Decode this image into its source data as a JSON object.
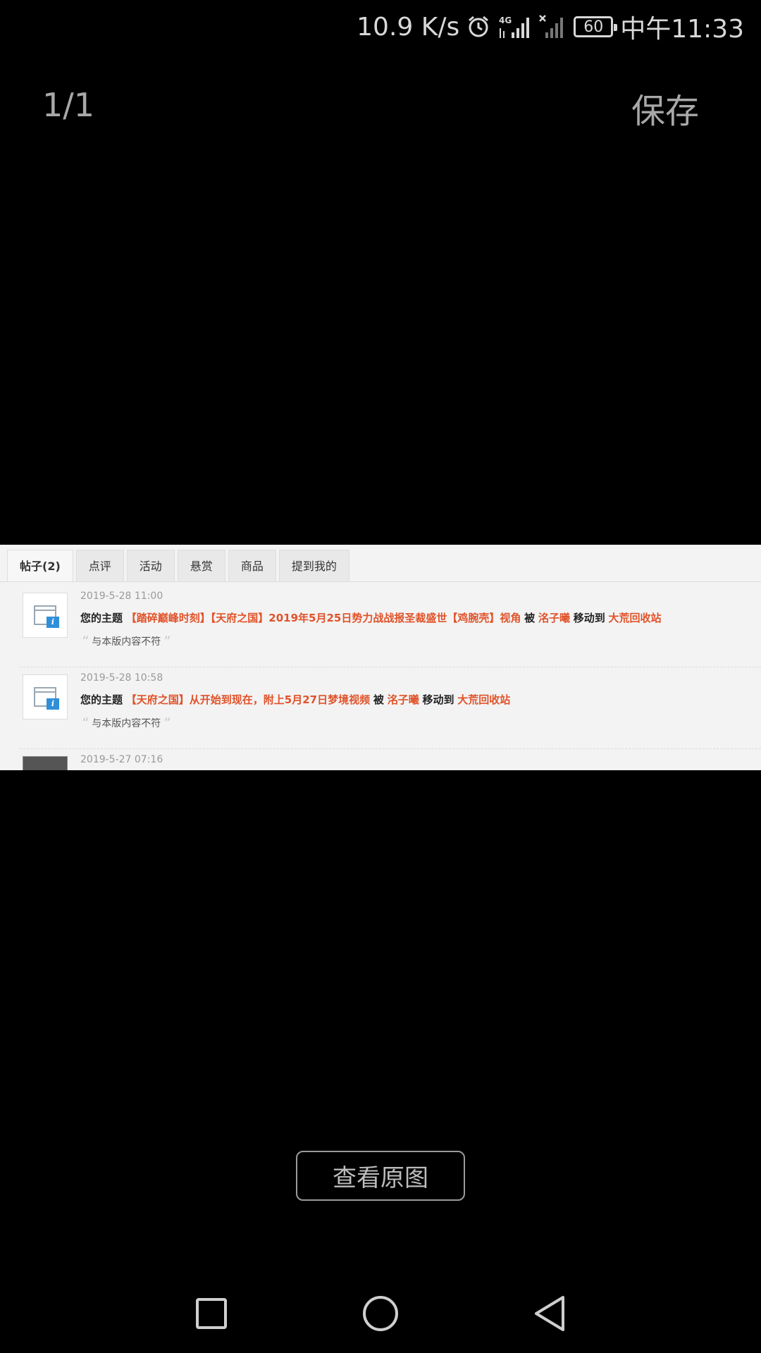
{
  "status_bar": {
    "net_speed": "10.9 K/s",
    "network": "4G",
    "battery": "60",
    "time": "中午11:33",
    "icons": [
      "alarm-icon",
      "signal-4g-icon",
      "signal-no-sim-icon",
      "battery-icon"
    ]
  },
  "viewer": {
    "page_counter": "1/1",
    "save_label": "保存",
    "view_original_label": "查看原图"
  },
  "image": {
    "tabs": [
      "帖子(2)",
      "点评",
      "活动",
      "悬赏",
      "商品",
      "提到我的"
    ],
    "active_tab": 0,
    "notices": [
      {
        "time": "2019-5-28 11:00",
        "prefix": "您的主题",
        "title": "【踏碎巅峰时刻】【天府之国】2019年5月25日势力战战报圣裁盛世【鸡腕壳】视角",
        "by": "被",
        "user": "洺子曦",
        "moved_to": "移动到",
        "forum": "大荒回收站",
        "reason": "与本版内容不符"
      },
      {
        "time": "2019-5-28 10:58",
        "prefix": "您的主题",
        "title": "【天府之国】从开始到现在，附上5月27日梦境视频",
        "by": "被",
        "user": "洺子曦",
        "moved_to": "移动到",
        "forum": "大荒回收站",
        "reason": "与本版内容不符"
      },
      {
        "time": "2019-5-27 07:16"
      }
    ]
  },
  "nav_bar": {
    "icons": [
      "recents-square-icon",
      "home-circle-icon",
      "back-triangle-icon"
    ]
  },
  "colors": {
    "background": "#000000",
    "link": "#e0532a",
    "panel": "#f3f3f3"
  }
}
